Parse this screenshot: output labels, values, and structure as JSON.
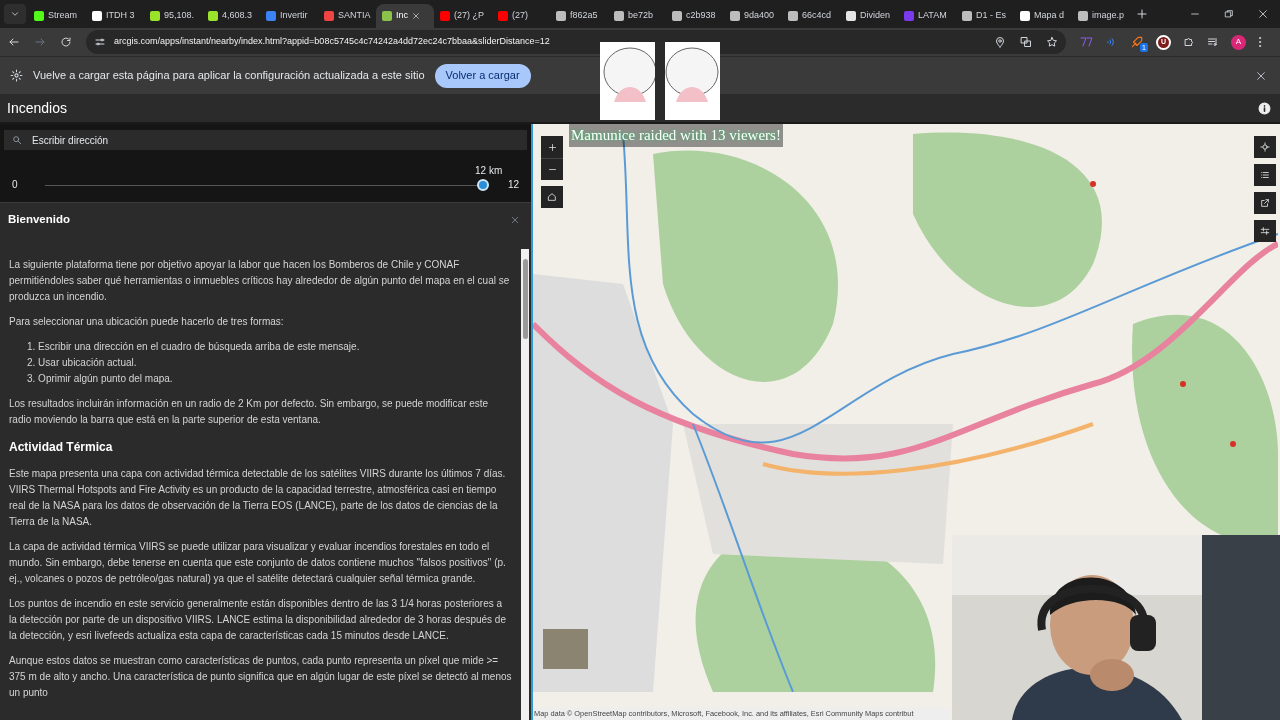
{
  "browser": {
    "tabs": [
      {
        "title": "Stream",
        "color": "#53fc18",
        "selected": false
      },
      {
        "title": "ITDH 3",
        "color": "#ffffff",
        "selected": false
      },
      {
        "title": "95,108.",
        "color": "#9be22d",
        "selected": false
      },
      {
        "title": "4,608.3",
        "color": "#9be22d",
        "selected": false
      },
      {
        "title": "Invertir",
        "color": "#3b82f6",
        "selected": false
      },
      {
        "title": "SANTIA",
        "color": "#ef4444",
        "selected": false
      },
      {
        "title": "Inc",
        "color": "#8bc34a",
        "selected": true
      },
      {
        "title": "(27) ¿P",
        "color": "#ff0000",
        "selected": false
      },
      {
        "title": "(27)",
        "color": "#ff0000",
        "selected": false
      },
      {
        "title": "f862a5",
        "color": "#bdbdbd",
        "selected": false
      },
      {
        "title": "be72b",
        "color": "#bdbdbd",
        "selected": false
      },
      {
        "title": "c2b938",
        "color": "#bdbdbd",
        "selected": false
      },
      {
        "title": "9da400",
        "color": "#bdbdbd",
        "selected": false
      },
      {
        "title": "66c4cd",
        "color": "#bdbdbd",
        "selected": false
      },
      {
        "title": "Dividen",
        "color": "#e5e5e5",
        "selected": false
      },
      {
        "title": "LATAM",
        "color": "#7c3aed",
        "selected": false
      },
      {
        "title": "D1 - Es",
        "color": "#bdbdbd",
        "selected": false
      },
      {
        "title": "Mapa d",
        "color": "#ffffff",
        "selected": false
      },
      {
        "title": "image.p",
        "color": "#bdbdbd",
        "selected": false
      }
    ],
    "address": "arcgis.com/apps/instant/nearby/index.html?appid=b08c5745c4c74242a4dd72ec24c7bbaa&sliderDistance=12",
    "extension_letter": "U",
    "extension_badge": "1",
    "profile_initial": "A"
  },
  "infobar": {
    "message": "Vuelve a cargar esta página para aplicar la configuración actualizada a este sitio",
    "button": "Volver a cargar"
  },
  "app": {
    "title": "Incendios",
    "search": {
      "placeholder": "Escribir dirección"
    },
    "slider": {
      "min": "0",
      "max": "12",
      "reading": "12 km",
      "level": 1
    },
    "welcome": {
      "title": "Bienvenido",
      "blocks": [
        {
          "kind": "p",
          "text": "La siguiente plataforma tiene por objetivo apoyar la labor que hacen los Bomberos de Chile y CONAF permitiéndoles saber qué herramientas o inmuebles críticos hay alrededor de algún punto del mapa en el cual se produzca un incendio."
        },
        {
          "kind": "p",
          "text": "Para seleccionar una ubicación puede hacerlo de tres formas:"
        },
        {
          "kind": "list",
          "items": [
            "1. Escribir una dirección en el cuadro de búsqueda arriba de este mensaje.",
            "2. Usar ubicación actual.",
            "3. Oprimir algún punto del mapa."
          ]
        },
        {
          "kind": "p",
          "text": "Los resultados incluirán información en un radio de 2 Km por defecto. Sin embargo, se puede modificar este radio moviendo la barra que está en la parte superior de esta ventana."
        },
        {
          "kind": "heading",
          "text": "Actividad Térmica"
        },
        {
          "kind": "p",
          "text": "Este mapa presenta una capa con actividad térmica detectable de los satélites VIIRS durante los últimos 7 días. VIIRS Thermal Hotspots and Fire Activity es un producto de la capacidad terrestre, atmosférica casi en tiempo real de la NASA para los datos de observación de la Tierra EOS (LANCE), parte de los datos de ciencias de la Tierra de la NASA."
        },
        {
          "kind": "p",
          "text": "La capa de actividad térmica VIIRS se puede utilizar para visualizar y evaluar incendios forestales en todo el mundo. Sin embargo, debe tenerse en cuenta que este conjunto de datos contiene muchos \"falsos positivos\" (p. ej., volcanes o pozos de petróleo/gas natural) ya que el satélite detectará cualquier señal térmica grande."
        },
        {
          "kind": "p",
          "text": "Los puntos de incendio en este servicio generalmente están disponibles dentro de las 3 1/4 horas posteriores a la detección por parte de un dispositivo VIIRS. LANCE estima la disponibilidad alrededor de 3 horas después de la detección, y esri livefeeds actualiza esta capa de características cada 15 minutos desde LANCE."
        },
        {
          "kind": "p",
          "text": "Aunque estos datos se muestran como características de puntos, cada punto representa un píxel que mide >= 375 m de alto y ancho. Una característica de punto significa que en algún lugar de este píxel se detectó al menos un punto"
        }
      ]
    }
  },
  "map": {
    "attribution": "Map data © OpenStreetMap contributors, Microsoft, Facebook, Inc. and its affiliates, Esri Community Maps contribut"
  },
  "overlay": {
    "raid_text": "Mamunice raided with 13 viewers!"
  }
}
